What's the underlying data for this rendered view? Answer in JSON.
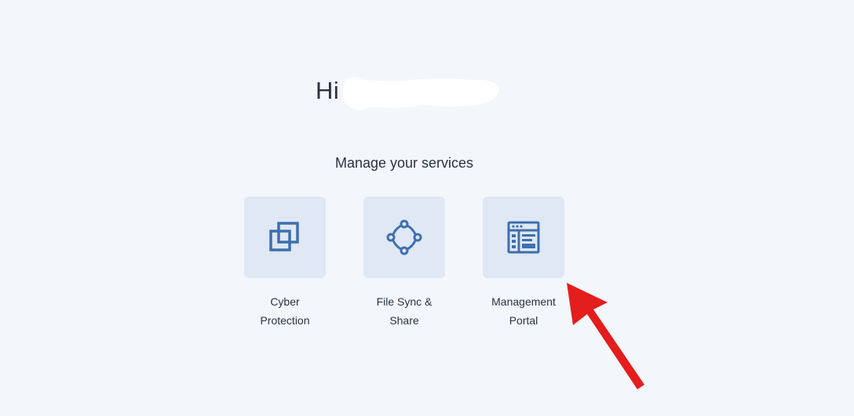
{
  "greeting": {
    "text": "Hi"
  },
  "services_heading": "Manage your services",
  "services": [
    {
      "label": "Cyber\nProtection",
      "icon": "cyber-protection-icon"
    },
    {
      "label": "File Sync &\nShare",
      "icon": "file-sync-icon"
    },
    {
      "label": "Management\nPortal",
      "icon": "management-portal-icon"
    }
  ],
  "colors": {
    "background": "#f3f6fb",
    "tile": "#dfe8f4",
    "icon": "#3f6fae",
    "text": "#2a3342",
    "arrow": "#e41d1d"
  }
}
